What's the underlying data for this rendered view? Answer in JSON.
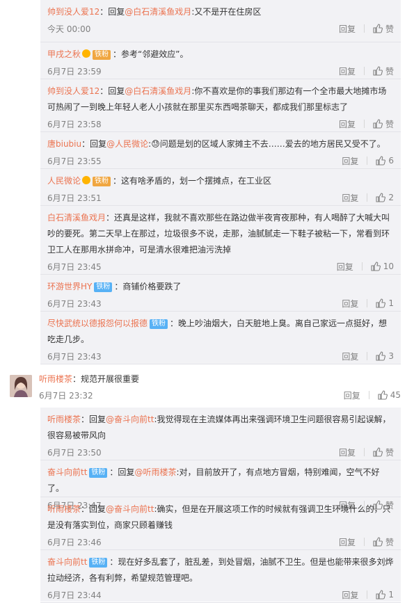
{
  "thread1": [
    {
      "user": "帅到没人爱12",
      "badge": "",
      "prefix": "：回复",
      "at": "@白石清溪鱼戏月",
      "content": ":又不是开在住房区",
      "time": "今天 00:00",
      "reply": "回复",
      "like": "赞"
    },
    {
      "user": "甲戌之秋",
      "badge": "铁粉",
      "badge_style": "gold",
      "vip": true,
      "prefix": "：",
      "at": "",
      "content": "参考“邻避效应”。",
      "time": "6月7日 23:59",
      "reply": "回复",
      "like": "赞"
    },
    {
      "user": "帅到没人爱12",
      "badge": "",
      "prefix": "：回复",
      "at": "@白石清溪鱼戏月",
      "content": ":你不喜欢是你的事我们那边有一个全市最大地摊市场可热闹了一到晚上年轻人老人小孩就在那里买东西喝茶聊天，都成我们那里标志了",
      "time": "6月7日 23:58",
      "reply": "回复",
      "like": "赞"
    },
    {
      "user": "唐biubiu",
      "badge": "",
      "prefix": "：回复",
      "at": "@人民微论",
      "content": ":😓问题是划的区域人家摊主不去……爱去的地方居民又受不了。",
      "time": "6月7日 23:55",
      "reply": "回复",
      "like": "6"
    },
    {
      "user": "人民微论",
      "badge": "铁粉",
      "badge_style": "gold",
      "vip": true,
      "prefix": "：",
      "at": "",
      "content": "这有啥矛盾的，划一个摆摊点，在工业区",
      "time": "6月7日 23:51",
      "reply": "回复",
      "like": "2"
    },
    {
      "user": "白石清溪鱼戏月",
      "badge": "",
      "prefix": "：",
      "at": "",
      "content": "还真是这样，我就不喜欢那些在路边做半夜宵夜那种，有人喝醉了大喊大叫吵的要死。第二天早上在那过，垃圾很多不说，走那，油腻腻走一下鞋子被粘一下，常看到环卫工人在那用水拼命冲，可是清水很难把油污洗掉",
      "time": "6月7日 23:45",
      "reply": "回复",
      "like": "10"
    },
    {
      "user": "环游世界HY",
      "badge": "铁粉",
      "badge_style": "blue",
      "prefix": "：",
      "at": "",
      "content": "商铺价格要跌了",
      "time": "6月7日 23:43",
      "reply": "回复",
      "like": "1"
    },
    {
      "user": "尽快武统以德报怨何以报德",
      "badge": "铁粉",
      "badge_style": "blue",
      "prefix": "：",
      "at": "",
      "content": "晚上吵油烟大，白天脏地上臭。离自己家远一点挺好，想吃走几步。",
      "time": "6月7日 23:43",
      "reply": "回复",
      "like": "3"
    }
  ],
  "top_comment": {
    "user": "听雨楼茶",
    "content": "：规范开展很重要",
    "time": "6月7日 23:32",
    "reply": "回复",
    "like": "45"
  },
  "thread2": [
    {
      "user": "听雨楼茶",
      "badge": "",
      "prefix": "：回复",
      "at": "@奋斗向前tt",
      "content": ":我觉得现在主流媒体再出来强调环境卫生问题很容易引起误解，很容易被带风向",
      "time": "6月7日 23:50",
      "reply": "回复",
      "like": "赞"
    },
    {
      "user": "奋斗向前tt",
      "badge": "铁粉",
      "badge_style": "blue",
      "prefix": "：回复",
      "at": "@听雨楼茶",
      "content": ":对，目前放开了，有点地方冒烟，特别难闻，空气不好了。",
      "time": "6月7日 23:47",
      "reply": "回复",
      "like": "赞"
    },
    {
      "user": "听雨楼茶",
      "badge": "",
      "prefix": "：回复",
      "at": "@奋斗向前tt",
      "content": ":确实，但是在开展这项工作的时候就有强调卫生环境什么的，只是没有落实到位，商家只顾着赚钱",
      "time": "6月7日 23:46",
      "reply": "回复",
      "like": "赞"
    },
    {
      "user": "奋斗向前tt",
      "badge": "铁粉",
      "badge_style": "blue",
      "prefix": "：",
      "at": "",
      "content": "现在好多乱套了，脏乱差，到处冒烟，油腻不卫生。但是也能带来很多刘烨拉动经济，各有利弊，希望规范管理吧。",
      "time": "6月7日 23:44",
      "reply": "回复",
      "like": "1"
    }
  ]
}
